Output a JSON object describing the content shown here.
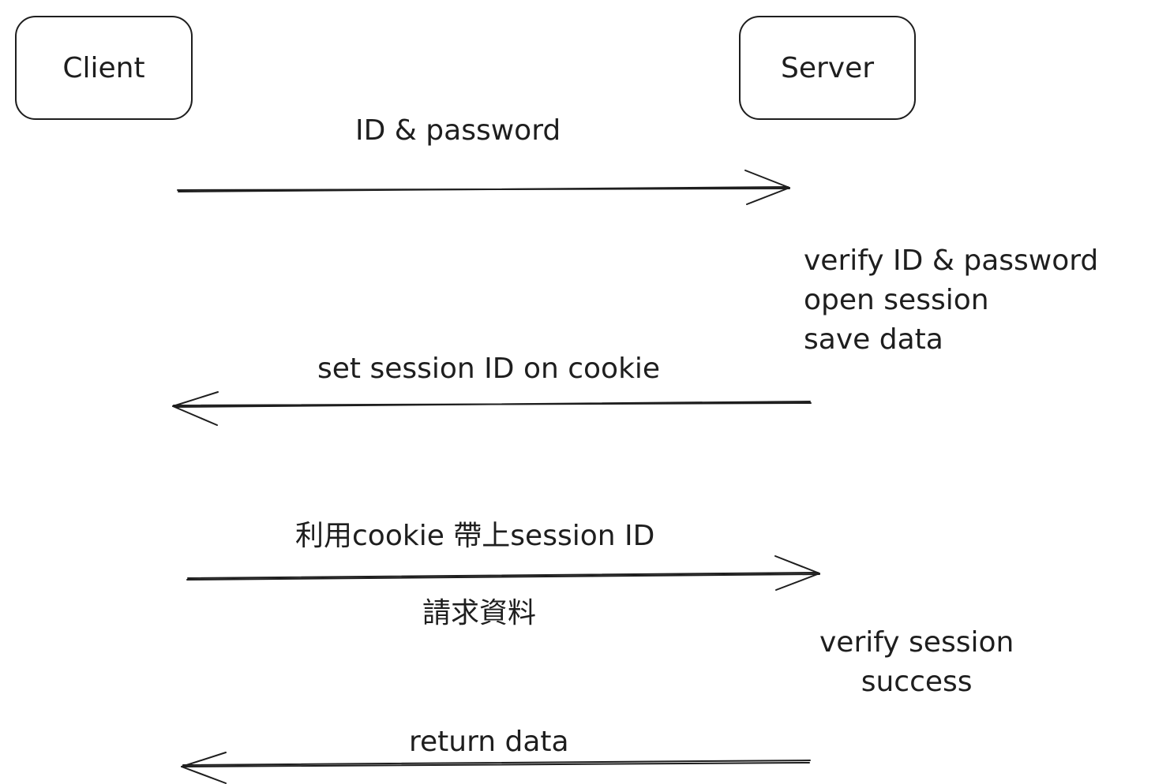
{
  "nodes": {
    "client": {
      "label": "Client"
    },
    "server": {
      "label": "Server"
    }
  },
  "messages": {
    "login": {
      "label": "ID & password"
    },
    "set_cookie": {
      "label": "set session ID on cookie"
    },
    "request": {
      "label": "利用cookie 帶上session ID",
      "sublabel": "請求資料"
    },
    "response": {
      "label": "return data"
    }
  },
  "notes": {
    "server_login": {
      "lines": [
        "verify ID & password",
        "open session",
        "save data"
      ]
    },
    "server_verify": {
      "lines": [
        "verify session",
        "success"
      ]
    }
  },
  "colors": {
    "stroke": "#1e1e1e",
    "background": "#ffffff"
  }
}
